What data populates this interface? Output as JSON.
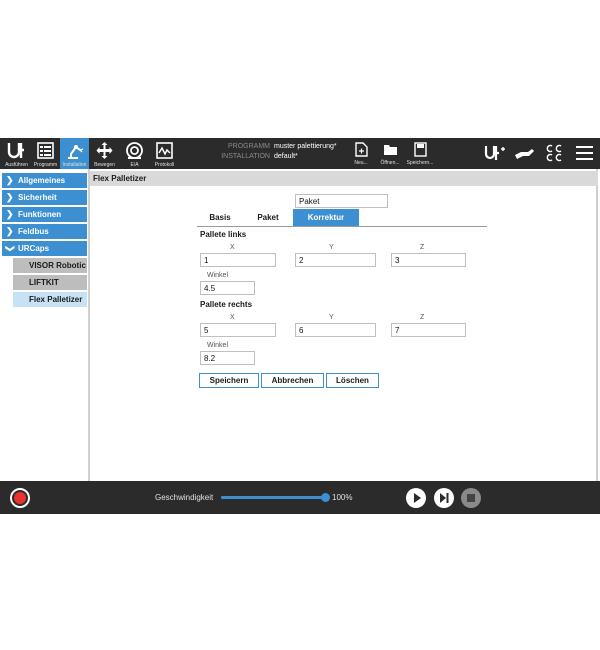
{
  "header": {
    "nav": [
      {
        "label": "Ausführen",
        "icon": "ur-logo-icon"
      },
      {
        "label": "Programm",
        "icon": "program-icon"
      },
      {
        "label": "Installation",
        "icon": "installation-robot-arm-icon"
      },
      {
        "label": "Bewegen",
        "icon": "move-arrows-icon"
      },
      {
        "label": "E/A",
        "icon": "io-gauge-icon"
      },
      {
        "label": "Protokoll",
        "icon": "log-chart-icon"
      }
    ],
    "program_key": "PROGRAMM",
    "program_value": "muster palettierung*",
    "installation_key": "INSTALLATION",
    "installation_value": "default*",
    "file_actions": [
      {
        "label": "Neu...",
        "icon": "new-file-icon"
      },
      {
        "label": "Öffnen...",
        "icon": "open-folder-icon"
      },
      {
        "label": "Speichern...",
        "icon": "save-disk-icon"
      }
    ]
  },
  "sidebar": {
    "items": [
      {
        "label": "Allgemeines"
      },
      {
        "label": "Sicherheit"
      },
      {
        "label": "Funktionen"
      },
      {
        "label": "Feldbus"
      },
      {
        "label": "URCaps"
      }
    ],
    "sub_items": [
      {
        "label": "VISOR Robotic"
      },
      {
        "label": "LIFTKIT"
      },
      {
        "label": "Flex Palletizer"
      }
    ]
  },
  "main": {
    "title": "Flex Palletizer",
    "package_field": "Paket",
    "tabs": [
      "Basis",
      "Paket",
      "Korrektur"
    ],
    "active_tab": "Korrektur",
    "left": {
      "title": "Pallete links",
      "x_label": "X",
      "y_label": "Y",
      "z_label": "Z",
      "x": "1",
      "y": "2",
      "z": "3",
      "angle_label": "Winkel",
      "angle": "4.5"
    },
    "right": {
      "title": "Pallete rechts",
      "x_label": "X",
      "y_label": "Y",
      "z_label": "Z",
      "x": "5",
      "y": "6",
      "z": "7",
      "angle_label": "Winkel",
      "angle": "8.2"
    },
    "buttons": {
      "save": "Speichern",
      "cancel": "Abbrechen",
      "delete": "Löschen"
    }
  },
  "footer": {
    "speed_label": "Geschwindigkeit",
    "speed_value": "100%",
    "speed_fraction": 1.0,
    "colors": {
      "accent": "#3c8fd0",
      "record": "#e8322b"
    }
  }
}
